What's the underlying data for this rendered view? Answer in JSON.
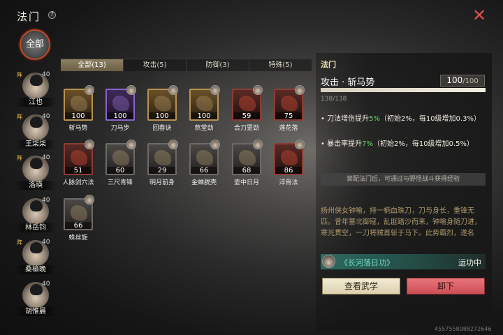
{
  "header": {
    "title": "法门",
    "help": "?",
    "close": "✕"
  },
  "sidebar": {
    "all_label": "全部",
    "characters": [
      {
        "name": "江也",
        "level": "40",
        "tag": "阵"
      },
      {
        "name": "王柒柒",
        "level": "40",
        "tag": "阵"
      },
      {
        "name": "洛瑛",
        "level": "40",
        "tag": "阵"
      },
      {
        "name": "林岳钧",
        "level": "40",
        "tag": ""
      },
      {
        "name": "桑榆晚",
        "level": "40",
        "tag": "阵"
      },
      {
        "name": "胡惟晨",
        "level": "40",
        "tag": ""
      }
    ]
  },
  "tabs": [
    {
      "label": "全部(13)",
      "active": true
    },
    {
      "label": "攻击(5)",
      "active": false
    },
    {
      "label": "防御(3)",
      "active": false
    },
    {
      "label": "特殊(5)",
      "active": false
    }
  ],
  "skills": [
    {
      "name": "斩马势",
      "value": "100",
      "rarity": "gold"
    },
    {
      "name": "刀马步",
      "value": "100",
      "rarity": "purple"
    },
    {
      "name": "回春诀",
      "value": "100",
      "rarity": "gold"
    },
    {
      "name": "熬堂劲",
      "value": "100",
      "rarity": "gold"
    },
    {
      "name": "合刀罡劲",
      "value": "59",
      "rarity": "red"
    },
    {
      "name": "莲花落",
      "value": "75",
      "rarity": "red"
    },
    {
      "name": "人脉剑穴法",
      "value": "51",
      "rarity": "red"
    },
    {
      "name": "三尺青锋",
      "value": "60",
      "rarity": "gray"
    },
    {
      "name": "明月前身",
      "value": "29",
      "rarity": "gray"
    },
    {
      "name": "金蝉脱壳",
      "value": "66",
      "rarity": "gray"
    },
    {
      "name": "壶中日月",
      "value": "68",
      "rarity": "gray"
    },
    {
      "name": "淬骨法",
      "value": "86",
      "rarity": "red"
    },
    {
      "name": "蛛丝旋",
      "value": "66",
      "rarity": "gray"
    }
  ],
  "detail": {
    "section_title": "法门",
    "skill_name": "攻击 · 斩马势",
    "level_current": "100",
    "level_max": "/100",
    "exp_text": "138/138",
    "exp_progress": 1.0,
    "bonuses": [
      {
        "bullet": "•",
        "pre": "刀法增伤提升",
        "value": "5%",
        "post": "（初始2%，每10级增加0.3%）"
      },
      {
        "bullet": "•",
        "pre": "暴击率提升",
        "value": "7%",
        "post": "（初始2%，每10级增加0.5%）"
      }
    ],
    "hint": "装配法门后，可通过与野怪战斗获得经验",
    "description": "扬州侠女钟喻，持一柄血珠刀，刀与身长，重锋无匹。昔年塞北御寇，乱匪踏沙而来，钟喻身随刀进，寒光贯空，一刀将贼首斩于马下。此势霸烈，遂名",
    "linked_martial": "《长河落日功》",
    "linked_status": "运功中",
    "view_button": "查看武学",
    "unequip_button": "卸下"
  },
  "uid": "4557558988272646",
  "colors": {
    "accent_red": "#e24d52",
    "green_value": "#6bd36b",
    "teal_text": "#72d8c4",
    "gold_text": "#f4e5b6"
  }
}
